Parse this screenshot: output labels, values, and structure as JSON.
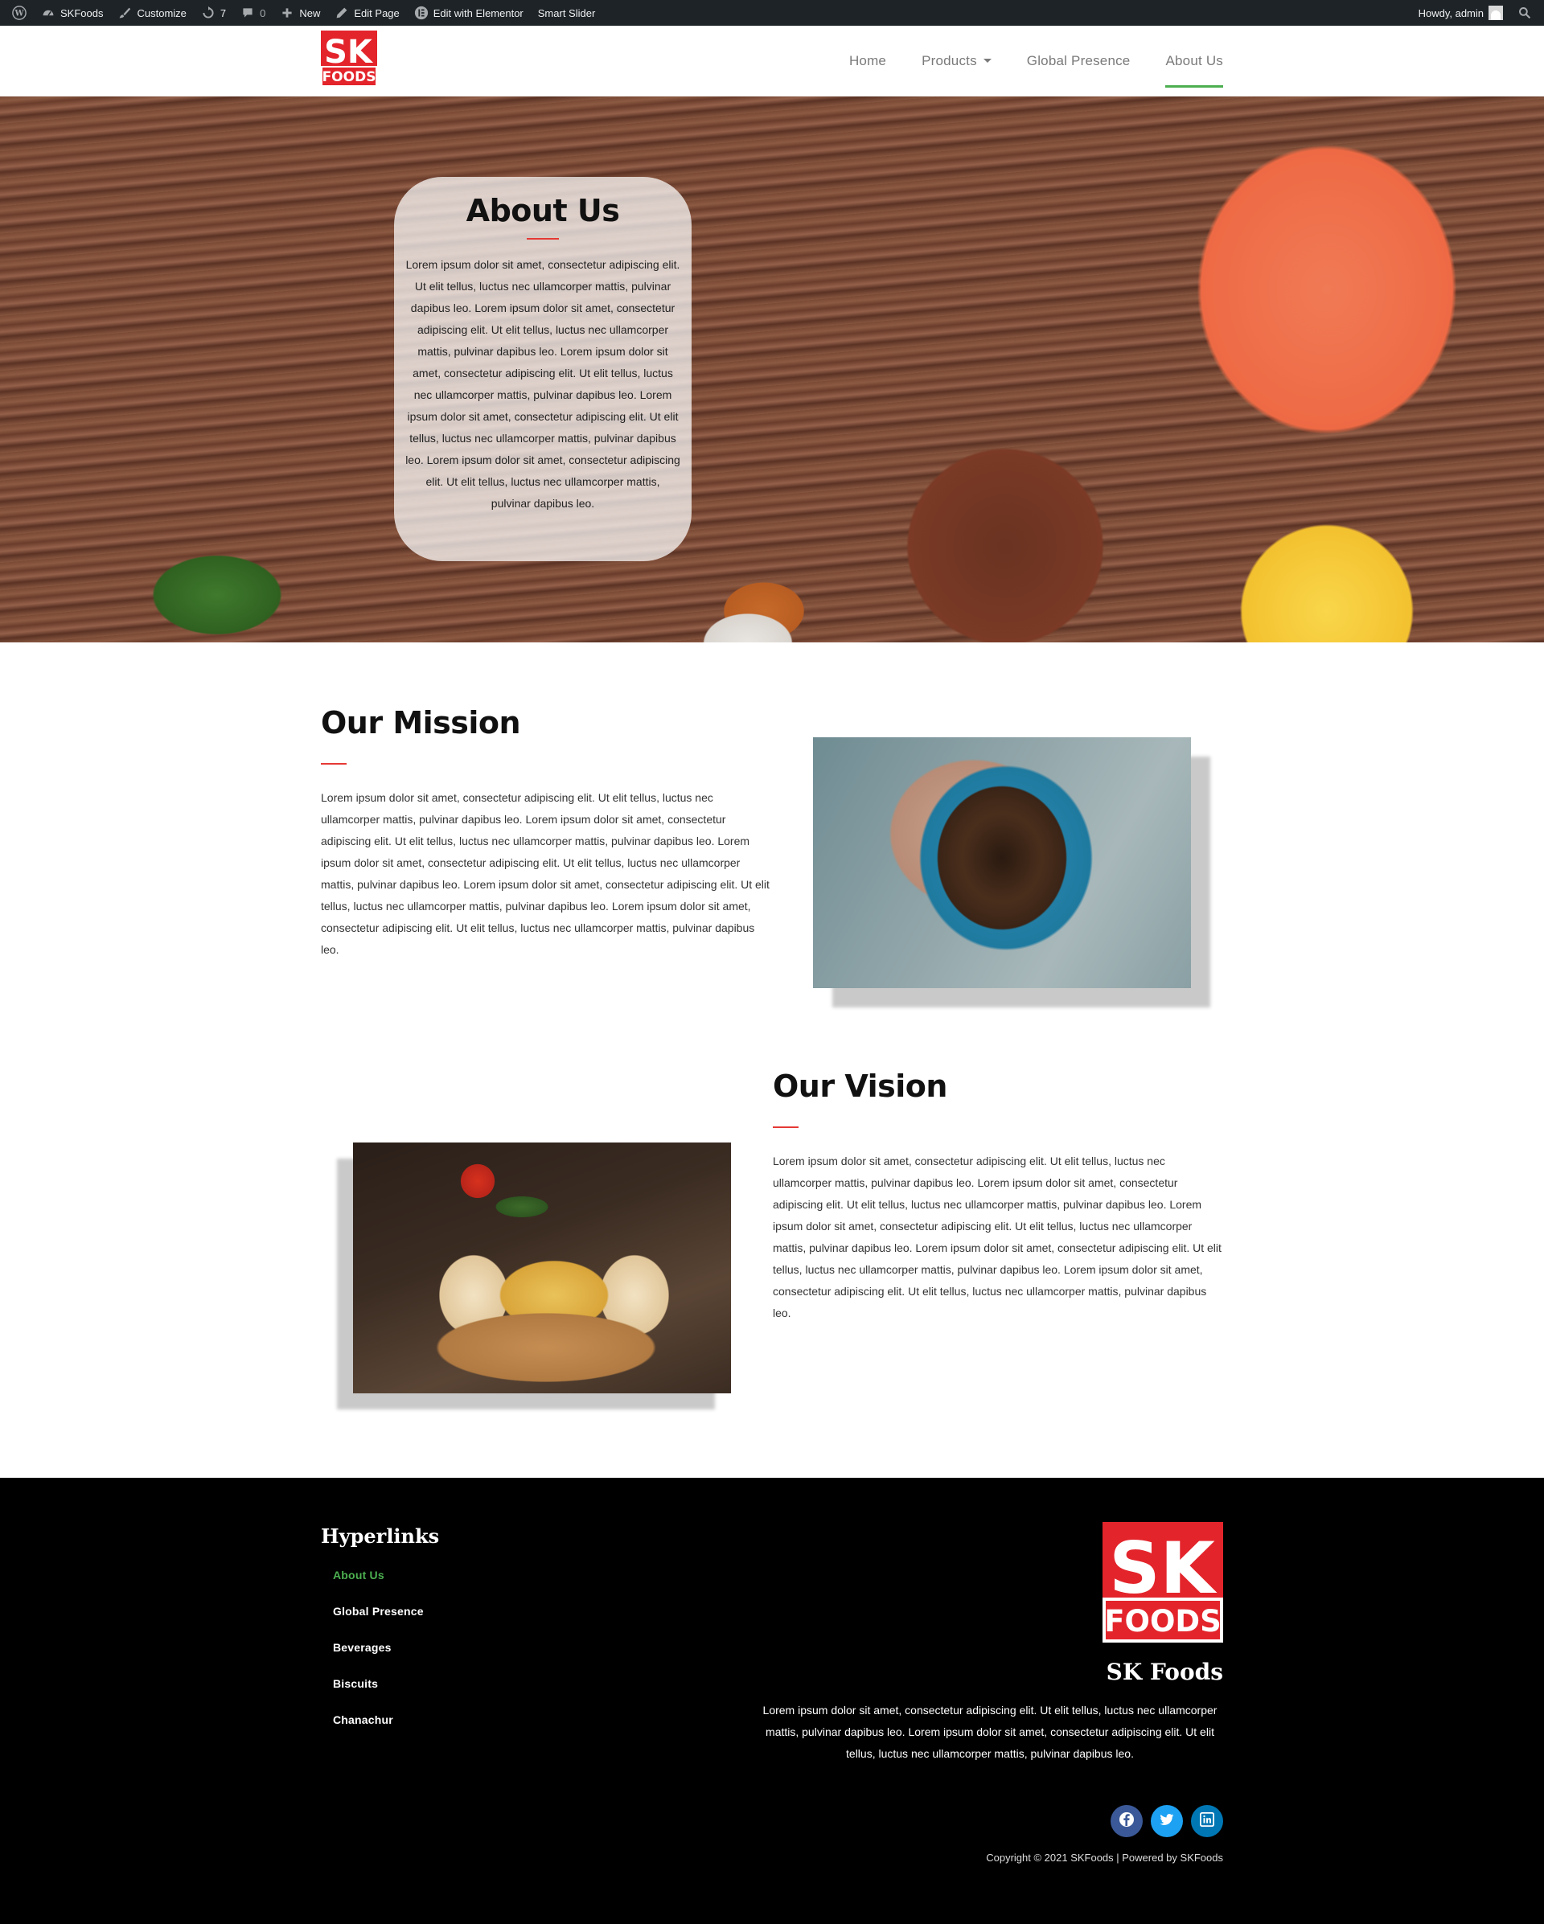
{
  "adminbar": {
    "site_name": "SKFoods",
    "customize": "Customize",
    "updates_count": "7",
    "comments_count": "0",
    "new": "New",
    "edit_page": "Edit Page",
    "edit_elementor": "Edit with Elementor",
    "smart_slider": "Smart Slider",
    "howdy": "Howdy, admin"
  },
  "header": {
    "logo_top": "SK",
    "logo_bottom": "FOODS",
    "nav": [
      {
        "label": "Home"
      },
      {
        "label": "Products"
      },
      {
        "label": "Global Presence"
      },
      {
        "label": "About Us"
      }
    ]
  },
  "hero": {
    "title": "About Us",
    "text": "Lorem ipsum dolor sit amet, consectetur adipiscing elit. Ut elit tellus, luctus nec ullamcorper mattis, pulvinar dapibus leo. Lorem ipsum dolor sit amet, consectetur adipiscing elit. Ut elit tellus, luctus nec ullamcorper mattis, pulvinar dapibus leo. Lorem ipsum dolor sit amet, consectetur adipiscing elit. Ut elit tellus, luctus nec ullamcorper mattis, pulvinar dapibus leo. Lorem ipsum dolor sit amet, consectetur adipiscing elit. Ut elit tellus, luctus nec ullamcorper mattis, pulvinar dapibus leo. Lorem ipsum dolor sit amet, consectetur adipiscing elit. Ut elit tellus, luctus nec ullamcorper mattis, pulvinar dapibus leo."
  },
  "mission": {
    "title": "Our Mission",
    "text": "Lorem ipsum dolor sit amet, consectetur adipiscing elit. Ut elit tellus, luctus nec ullamcorper mattis, pulvinar dapibus leo. Lorem ipsum dolor sit amet, consectetur adipiscing elit. Ut elit tellus, luctus nec ullamcorper mattis, pulvinar dapibus leo. Lorem ipsum dolor sit amet, consectetur adipiscing elit. Ut elit tellus, luctus nec ullamcorper mattis, pulvinar dapibus leo. Lorem ipsum dolor sit amet, consectetur adipiscing elit. Ut elit tellus, luctus nec ullamcorper mattis, pulvinar dapibus leo. Lorem ipsum dolor sit amet, consectetur adipiscing elit. Ut elit tellus, luctus nec ullamcorper mattis, pulvinar dapibus leo."
  },
  "vision": {
    "title": "Our Vision",
    "text": "Lorem ipsum dolor sit amet, consectetur adipiscing elit. Ut elit tellus, luctus nec ullamcorper mattis, pulvinar dapibus leo. Lorem ipsum dolor sit amet, consectetur adipiscing elit. Ut elit tellus, luctus nec ullamcorper mattis, pulvinar dapibus leo. Lorem ipsum dolor sit amet, consectetur adipiscing elit. Ut elit tellus, luctus nec ullamcorper mattis, pulvinar dapibus leo. Lorem ipsum dolor sit amet, consectetur adipiscing elit. Ut elit tellus, luctus nec ullamcorper mattis, pulvinar dapibus leo. Lorem ipsum dolor sit amet, consectetur adipiscing elit. Ut elit tellus, luctus nec ullamcorper mattis, pulvinar dapibus leo."
  },
  "footer": {
    "hyperlinks_title": "Hyperlinks",
    "links": [
      {
        "label": "About Us"
      },
      {
        "label": "Global Presence"
      },
      {
        "label": "Beverages"
      },
      {
        "label": "Biscuits"
      },
      {
        "label": "Chanachur"
      }
    ],
    "brand": "SK Foods",
    "description": "Lorem ipsum dolor sit amet, consectetur adipiscing elit. Ut elit tellus, luctus nec ullamcorper mattis, pulvinar dapibus leo. Lorem ipsum dolor sit amet, consectetur adipiscing elit. Ut elit tellus, luctus nec ullamcorper mattis, pulvinar dapibus leo.",
    "copyright": "Copyright © 2021 SKFoods | Powered by SKFoods",
    "socials": [
      "facebook",
      "twitter",
      "linkedin"
    ]
  },
  "colors": {
    "accent_green": "#4caf50",
    "divider_red": "#e53935",
    "logo_red": "#e3242b",
    "adminbar_bg": "#1d2327"
  }
}
